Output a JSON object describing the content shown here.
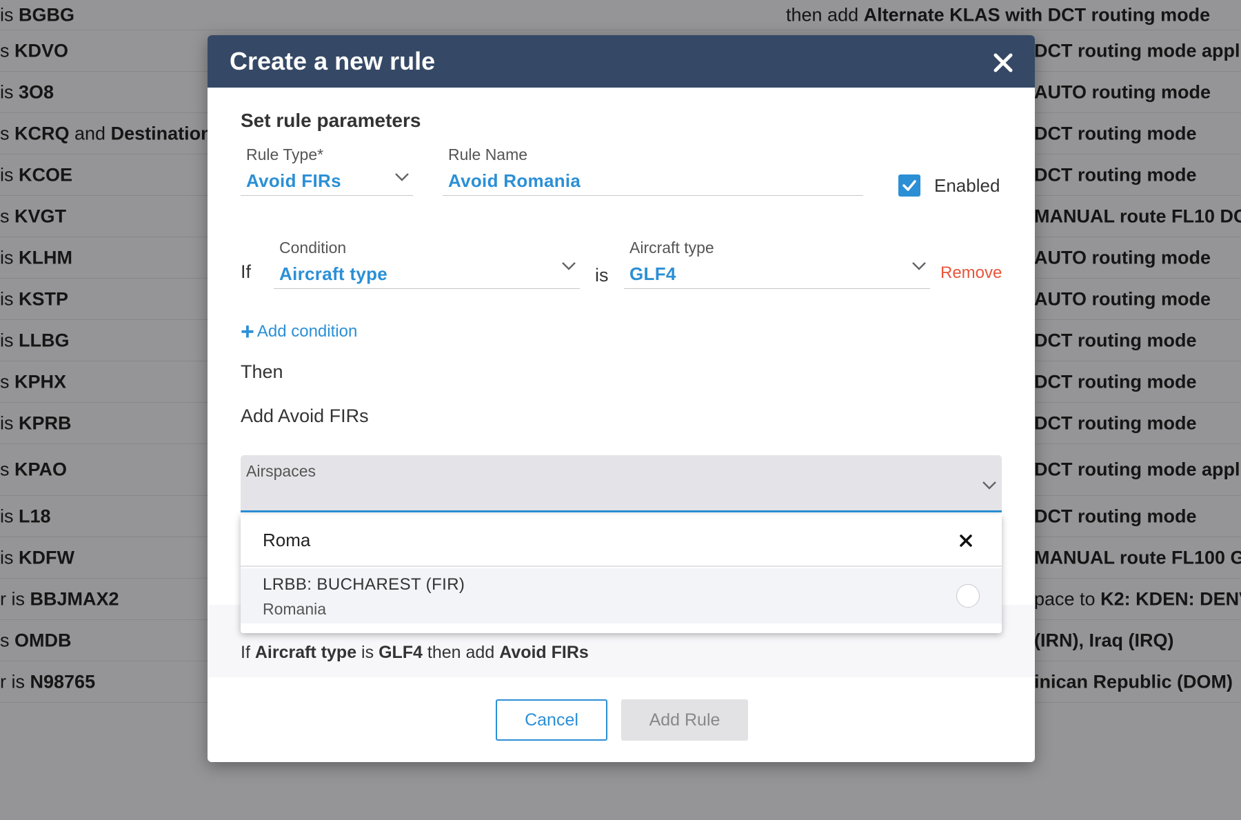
{
  "background_rows": [
    {
      "left": [
        "is ",
        "BGBG"
      ],
      "right": [
        "then add ",
        "Alternate KLAS with DCT routing mode"
      ],
      "wide": true
    },
    {
      "left": [
        "s ",
        "KDVO"
      ],
      "right": [
        "",
        "DCT routing mode appl"
      ]
    },
    {
      "left": [
        "is ",
        "3O8"
      ],
      "right": [
        "",
        "AUTO routing mode"
      ]
    },
    {
      "left": [
        "s ",
        "KCRQ",
        " and ",
        "Destination"
      ],
      "right": [
        "",
        "DCT routing mode"
      ]
    },
    {
      "left": [
        "is ",
        "KCOE"
      ],
      "right": [
        "",
        "DCT routing mode"
      ]
    },
    {
      "left": [
        "s ",
        "KVGT"
      ],
      "right": [
        "",
        "MANUAL route FL10 DC"
      ]
    },
    {
      "left": [
        "is ",
        "KLHM"
      ],
      "right": [
        "",
        "AUTO routing mode"
      ]
    },
    {
      "left": [
        "is ",
        "KSTP"
      ],
      "right": [
        "",
        "AUTO routing mode"
      ]
    },
    {
      "left": [
        "is ",
        "LLBG"
      ],
      "right": [
        "",
        "DCT routing mode"
      ]
    },
    {
      "left": [
        "s ",
        "KPHX"
      ],
      "right": [
        "",
        "DCT routing mode"
      ]
    },
    {
      "left": [
        "is ",
        "KPRB"
      ],
      "right": [
        "",
        "DCT routing mode"
      ]
    },
    {
      "left": [
        "s ",
        "KPAO"
      ],
      "right": [
        "",
        "DCT routing mode appli"
      ]
    },
    {
      "left": [
        "is ",
        "L18"
      ],
      "right": [
        "",
        "DCT routing mode"
      ]
    },
    {
      "left": [
        "is ",
        "KDFW"
      ],
      "right": [
        "",
        "MANUAL route FL100 G"
      ]
    },
    {
      "left": [
        "r is ",
        "BBJMAX2"
      ],
      "right": [
        "pace to ",
        "K2: KDEN: DENV"
      ]
    },
    {
      "left": [
        "s ",
        "OMDB"
      ],
      "right": [
        "",
        "(IRN), Iraq (IRQ)"
      ]
    },
    {
      "left": [
        "r is ",
        "N98765"
      ],
      "right": [
        "",
        "inican Republic (DOM)"
      ]
    }
  ],
  "modal": {
    "title": "Create a new rule",
    "section_title": "Set rule parameters",
    "rule_type": {
      "label": "Rule Type*",
      "value": "Avoid FIRs"
    },
    "rule_name": {
      "label": "Rule Name",
      "value": "Avoid Romania"
    },
    "enabled": {
      "label": "Enabled",
      "checked": true
    },
    "if_label": "If",
    "condition": {
      "label": "Condition",
      "value": "Aircraft type"
    },
    "is_label": "is",
    "condition_value": {
      "label": "Aircraft type",
      "value": "GLF4"
    },
    "remove_label": "Remove",
    "add_condition_label": "Add condition",
    "then_label": "Then",
    "action_label": "Add Avoid FIRs",
    "airspaces": {
      "label": "Airspaces",
      "search_value": "Roma",
      "options": [
        {
          "title": "LRBB: BUCHAREST (FIR)",
          "subtitle": "Romania"
        }
      ]
    },
    "summary": {
      "p1": "If ",
      "b1": "Aircraft type",
      "p2": " is ",
      "b2": "GLF4",
      "p3": " then add ",
      "b3": "Avoid FIRs"
    },
    "cancel_label": "Cancel",
    "add_rule_label": "Add Rule"
  },
  "colors": {
    "header": "#354966",
    "accent": "#2b8fd6",
    "danger": "#e8553a"
  }
}
